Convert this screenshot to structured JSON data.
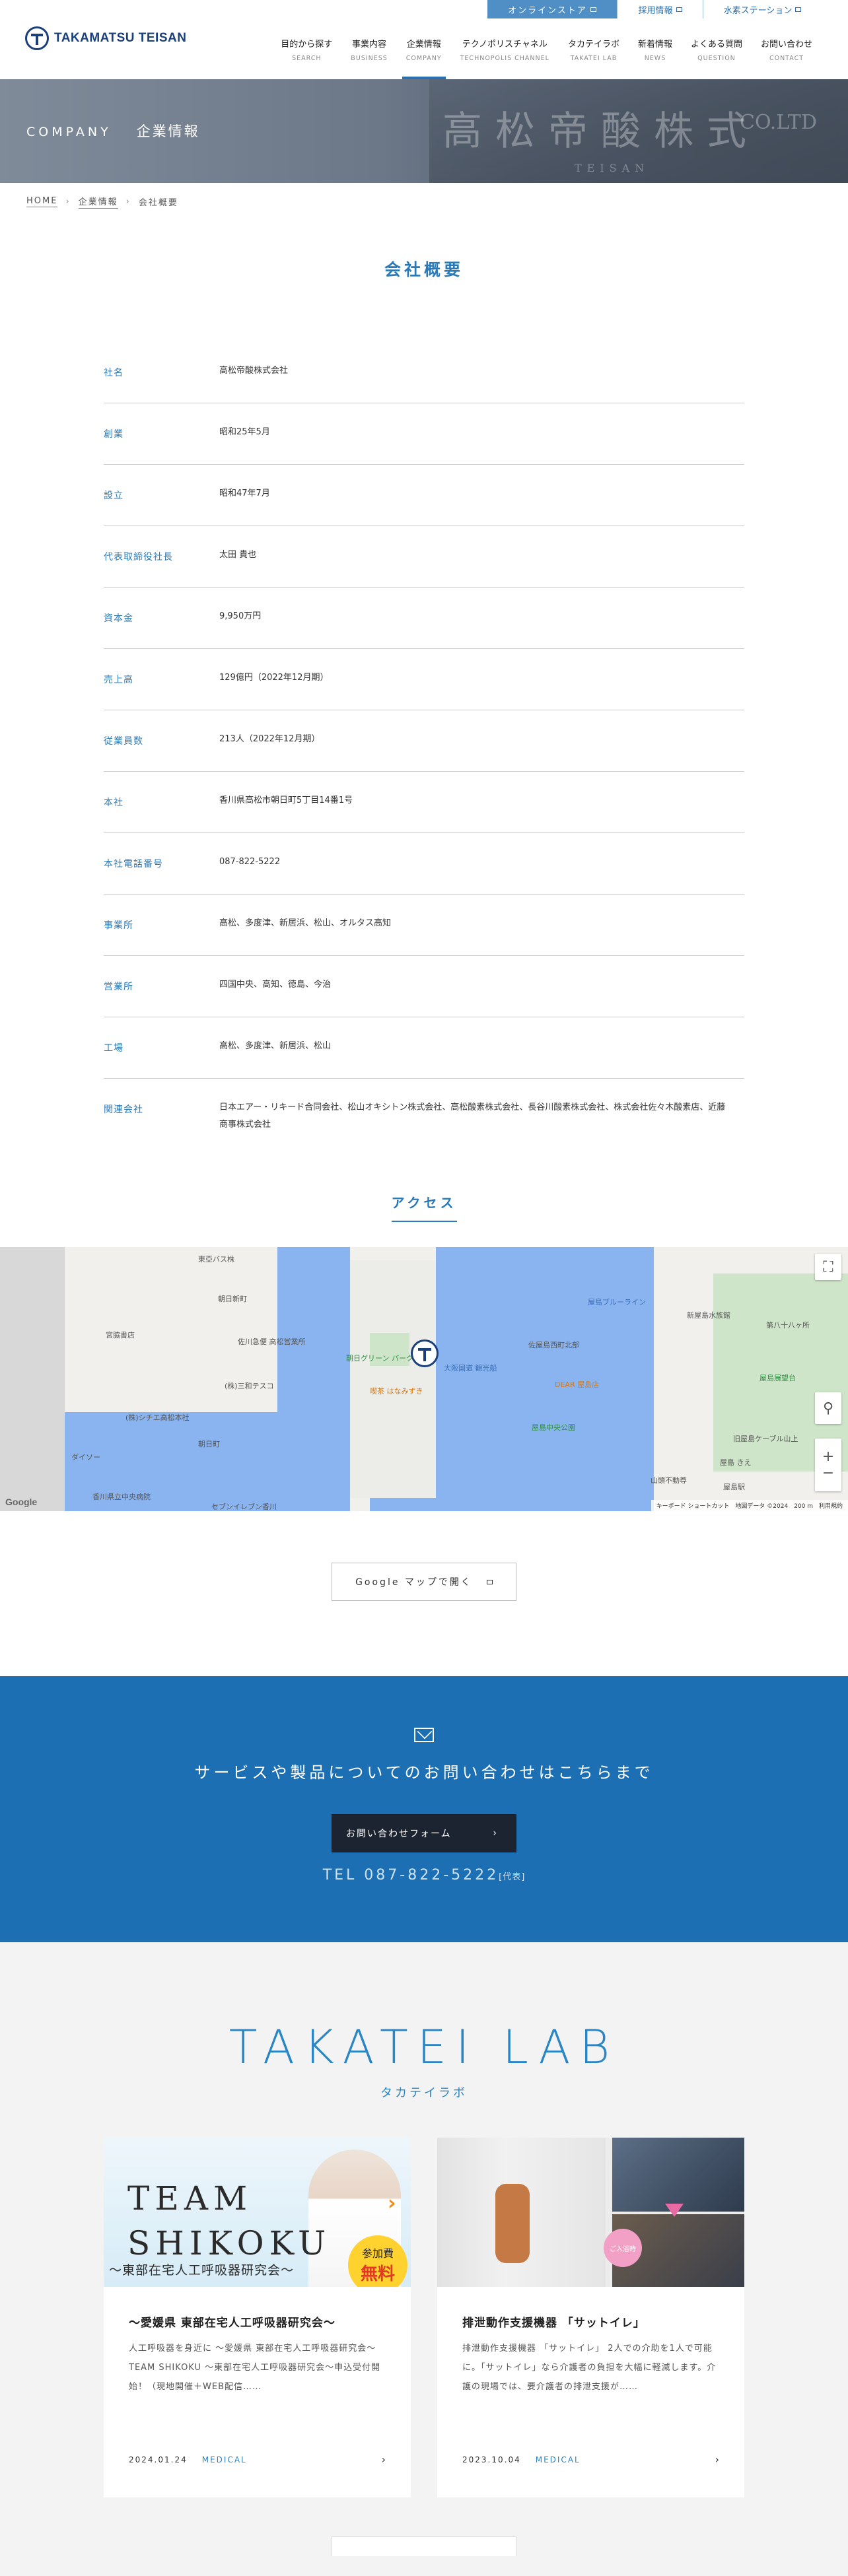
{
  "header": {
    "logo_text": "TAKAMATSU TEISAN",
    "topbar": {
      "shop_label": "オンラインストア",
      "links": [
        "採用情報",
        "水素ステーション"
      ]
    },
    "nav": [
      {
        "jp": "目的から探す",
        "en": "SEARCH"
      },
      {
        "jp": "事業内容",
        "en": "BUSINESS"
      },
      {
        "jp": "企業情報",
        "en": "COMPANY"
      },
      {
        "jp": "テクノポリスチャネル",
        "en": "TECHNOPOLIS CHANNEL"
      },
      {
        "jp": "タカテイラボ",
        "en": "TAKATEI LAB"
      },
      {
        "jp": "新着情報",
        "en": "NEWS"
      },
      {
        "jp": "よくある質問",
        "en": "QUESTION"
      },
      {
        "jp": "お問い合わせ",
        "en": "CONTACT"
      }
    ]
  },
  "hero": {
    "en": "COMPANY",
    "jp": "企業情報",
    "sign": [
      "高",
      "松",
      "帝",
      "酸",
      "株",
      "式"
    ],
    "sign_en": "CO.LTD",
    "sign_en2": "TEISAN"
  },
  "breadcrumb": {
    "home": "HOME",
    "parent": "企業情報",
    "current": "会社概要"
  },
  "overview": {
    "title": "会社概要",
    "rows": [
      {
        "k": "社名",
        "v": "高松帝酸株式会社"
      },
      {
        "k": "創業",
        "v": "昭和25年5月"
      },
      {
        "k": "設立",
        "v": "昭和47年7月"
      },
      {
        "k": "代表取締役社長",
        "v": "太田 貴也"
      },
      {
        "k": "資本金",
        "v": "9,950万円"
      },
      {
        "k": "売上高",
        "v": "129億円（2022年12月期）"
      },
      {
        "k": "従業員数",
        "v": "213人（2022年12月期）"
      },
      {
        "k": "本社",
        "v": "香川県高松市朝日町5丁目14番1号"
      },
      {
        "k": "本社電話番号",
        "v": "087-822-5222"
      },
      {
        "k": "事業所",
        "v": "高松、多度津、新居浜、松山、オルタス高知"
      },
      {
        "k": "営業所",
        "v": "四国中央、高知、徳島、今治"
      },
      {
        "k": "工場",
        "v": "高松、多度津、新居浜、松山"
      },
      {
        "k": "関連会社",
        "v": "日本エアー・リキード合同会社、松山オキシトン株式会社、高松酸素株式会社、長谷川酸素株式会社、株式会社佐々木酸素店、近藤商事株式会社"
      }
    ]
  },
  "access": {
    "title": "アクセス",
    "map": {
      "labels": [
        "東亞バス株",
        "朝日新町",
        "朝日新町",
        "佐川急便 高松営業所",
        "(株)三和テスコ",
        "(株)シチエ高松本社",
        "朝日町",
        "朝日グリーン パーク",
        "喫茶 はなみずき",
        "大阪国道 観光船",
        "香川県立中央病院",
        "セブンイレブン香川",
        "新屋島水族館",
        "屋島中央公園",
        "DEAR 屋島店",
        "屋島駅",
        "山頭不動尊",
        "屋島 きえ",
        "旧屋島ケーブル山上",
        "第八十八ヶ所",
        "屋島展望台",
        "屋島ブルーライン",
        "佐屋島西町北部",
        "宮脇書店",
        "ダイソー"
      ],
      "footer": "キーボード ショートカット　地図データ ©2024　200 m　利用規約",
      "google": "Google"
    },
    "button": "Google マップで開く"
  },
  "contact": {
    "lead": "サービスや製品についてのお問い合わせはこちらまで",
    "button": "お問い合わせフォーム",
    "button_arrow": "›",
    "tel": "TEL 087-822-5222",
    "tel_note": "[代表]"
  },
  "lab": {
    "title": "TAKATEI LAB",
    "subtitle": "タカテイラボ",
    "cards": [
      {
        "img_text1": "TEAM",
        "img_text2": "SHIKOKU",
        "img_text3": "～東部在宅人工呼吸器研究会～",
        "badge1": "参加費",
        "badge2": "無料",
        "title": "～愛媛県 東部在宅人工呼吸器研究会～",
        "desc": "人工呼吸器を身近に 〜愛媛県 東部在宅人工呼吸器研究会〜 TEAM SHIKOKU 〜東部在宅人工呼吸器研究会〜申込受付開始！（現地開催＋WEB配信……",
        "date": "2024.01.24",
        "category": "MEDICAL"
      },
      {
        "img_badge": "ご入浴時",
        "title": "排泄動作支援機器 「サットイレ」",
        "desc": "排泄動作支援機器 「サットイレ」 2人での介助を1人で可能に。「サットイレ」なら介護者の負担を大幅に軽減します。介護の現場では、要介護者の排泄支援が……",
        "date": "2023.10.04",
        "category": "MEDICAL"
      }
    ]
  },
  "colors": {
    "accent": "#2a7ab8",
    "contact_bg": "#1c6fb3",
    "shop_bg": "#4f8fc6",
    "dark_button": "#1b2430"
  }
}
